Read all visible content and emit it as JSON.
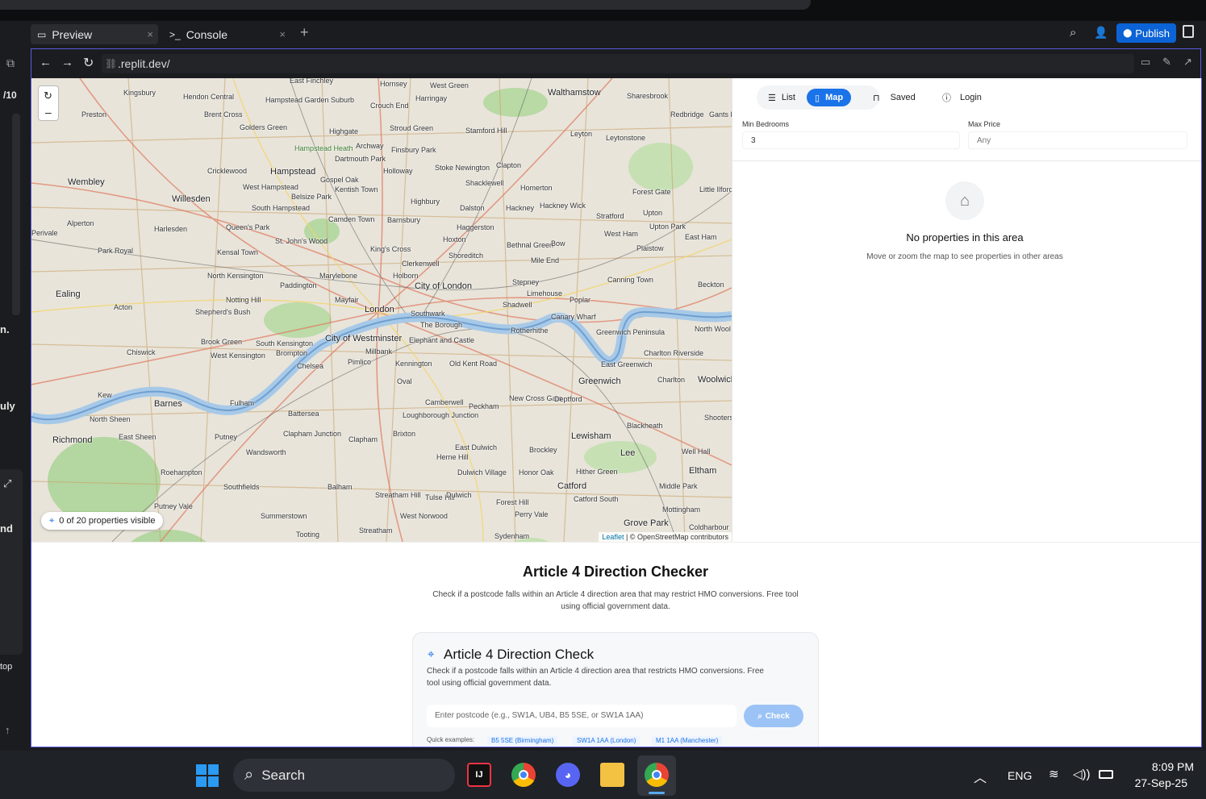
{
  "tabs": [
    {
      "label": "Preview"
    },
    {
      "label": "Console"
    }
  ],
  "toolbar": {
    "publish": "Publish"
  },
  "url": ".replit.dev/",
  "left_rail": {
    "count": "/10",
    "t1": "n.",
    "t2": "uly",
    "t3": "nd",
    "t4": "top"
  },
  "map": {
    "counter": "0 of 20 properties visible",
    "attribution_leaflet": "Leaflet",
    "attribution_rest": "| © OpenStreetMap contributors",
    "places": [
      "East Finchley",
      "Hornsey",
      "West Green",
      "Walthamstow",
      "Kingsbury",
      "Hendon Central",
      "Hampstead Garden Suburb",
      "Harringay",
      "Crouch End",
      "Sharesbrook",
      "Preston",
      "Brent Cross",
      "Golders Green",
      "Highgate",
      "Stroud Green",
      "Stamford Hill",
      "Leyton",
      "Leytonstone",
      "Redbridge",
      "Gants H",
      "Hampstead Heath",
      "Archway",
      "Finsbury Park",
      "Dartmouth Park",
      "Holloway",
      "Stoke Newington",
      "Clapton",
      "Cricklewood",
      "Hampstead",
      "Gospel Oak",
      "Kentish Town",
      "Wembley",
      "West Hampstead",
      "Belsize Park",
      "Shacklewell",
      "Homerton",
      "Forest Gate",
      "Little Ilford",
      "Willesden",
      "South Hampstead",
      "Highbury",
      "Dalston",
      "Hackney",
      "Hackney Wick",
      "Stratford",
      "Upton",
      "Alperton",
      "Camden Town",
      "Barnsbury",
      "Harlesden",
      "Queen's Park",
      "Haggerston",
      "Upton Park",
      "Perivale",
      "St. John's Wood",
      "Hoxton",
      "West Ham",
      "East Ham",
      "Park Royal",
      "Kensal Town",
      "King's Cross",
      "Shoreditch",
      "Bethnal Green",
      "Bow",
      "Plaistow",
      "Clerkenwell",
      "Mile End",
      "North Kensington",
      "Marylebone",
      "Holborn",
      "Canning Town",
      "Paddington",
      "City of London",
      "Stepney",
      "Beckton",
      "Ealing",
      "Notting Hill",
      "Mayfair",
      "Limehouse",
      "Poplar",
      "Acton",
      "Shepherd's Bush",
      "London",
      "Southwark",
      "Shadwell",
      "Canary Wharf",
      "The Borough",
      "Rotherhithe",
      "Greenwich Peninsula",
      "North Wool",
      "Brook Green",
      "South Kensington",
      "City of Westminster",
      "Elephant and Castle",
      "Chiswick",
      "West Kensington",
      "Brompton",
      "Millbank",
      "Charlton Riverside",
      "Chelsea",
      "Pimlico",
      "Kennington",
      "Old Kent Road",
      "East Greenwich",
      "Woolwich",
      "Oval",
      "Greenwich",
      "Charlton",
      "Kew",
      "Barnes",
      "Fulham",
      "New Cross Gate",
      "Deptford",
      "Camberwell",
      "Peckham",
      "Battersea",
      "Shooters",
      "North Sheen",
      "Loughborough Junction",
      "Blackheath",
      "Richmond",
      "East Sheen",
      "Putney",
      "Clapham Junction",
      "Clapham",
      "Brixton",
      "Lewisham",
      "East Dulwich",
      "Brockley",
      "Wandsworth",
      "Lee",
      "Herne Hill",
      "Well Hall",
      "Roehampton",
      "Dulwich Village",
      "Honor Oak",
      "Hither Green",
      "Eltham",
      "Southfields",
      "Balham",
      "Catford",
      "Middle Park",
      "Streatham Hill",
      "Tulse Hill",
      "Dulwich",
      "Catford South",
      "Putney Vale",
      "Forest Hill",
      "Mottingham",
      "Summerstown",
      "West Norwood",
      "Perry Vale",
      "Grove Park",
      "Tooting",
      "Streatham",
      "Sydenham",
      "Coldharbour"
    ]
  },
  "panel": {
    "seg_list": "List",
    "seg_map": "Map",
    "seg_saved": "Saved",
    "seg_login": "Login",
    "min_bedrooms_label": "Min Bedrooms",
    "min_bedrooms_value": "3",
    "max_price_label": "Max Price",
    "max_price_value": "Any",
    "empty_title": "No properties in this area",
    "empty_sub": "Move or zoom the map to see properties in other areas"
  },
  "article": {
    "heading": "Article 4 Direction Checker",
    "intro_line1": "Check if a postcode falls within an Article 4 direction area that may restrict HMO conversions. Free tool",
    "intro_line2": "using official government data.",
    "card_title": "Article 4 Direction Check",
    "card_line1": "Check if a postcode falls within an Article 4 direction area that restricts HMO conversions. Free",
    "card_line2": "tool using official government data.",
    "input_placeholder": "Enter postcode (e.g., SW1A, UB4, B5 5SE, or SW1A 1AA)",
    "check_button": "Check",
    "quick_label": "Quick examples:",
    "examples": [
      "B5 5SE (Birmingham)",
      "SW1A 1AA (London)",
      "M1 1AA (Manchester)"
    ]
  },
  "taskbar": {
    "search": "Search",
    "lang": "ENG",
    "time": "8:09 PM",
    "date": "27-Sep-25"
  },
  "colors": {
    "accent": "#1a73e8",
    "publish": "#0b63d6",
    "check": "#9cc3f5"
  }
}
